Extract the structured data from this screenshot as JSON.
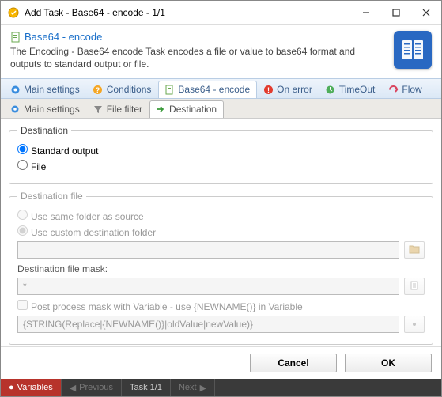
{
  "window": {
    "title": "Add Task - Base64 - encode - 1/1"
  },
  "header": {
    "task_title": "Base64 - encode",
    "description": "The Encoding - Base64 encode Task encodes a file or value to base64 format and outputs to standard output or file."
  },
  "tabs": {
    "main": "Main settings",
    "conditions": "Conditions",
    "encode": "Base64 - encode",
    "onerror": "On error",
    "timeout": "TimeOut",
    "flow": "Flow"
  },
  "subtabs": {
    "main": "Main settings",
    "filter": "File filter",
    "destination": "Destination"
  },
  "dest": {
    "legend": "Destination",
    "std": "Standard output",
    "file": "File"
  },
  "destfile": {
    "legend": "Destination file",
    "same": "Use same folder as source",
    "custom": "Use custom destination folder",
    "path_value": "",
    "mask_label": "Destination file mask:",
    "mask_value": "*",
    "postprocess": "Post process mask with Variable - use {NEWNAME()} in Variable",
    "expr": "{STRING(Replace|{NEWNAME()}|oldValue|newValue)}"
  },
  "buttons": {
    "cancel": "Cancel",
    "ok": "OK"
  },
  "status": {
    "variables": "Variables",
    "previous": "Previous",
    "task": "Task 1/1",
    "next": "Next"
  }
}
